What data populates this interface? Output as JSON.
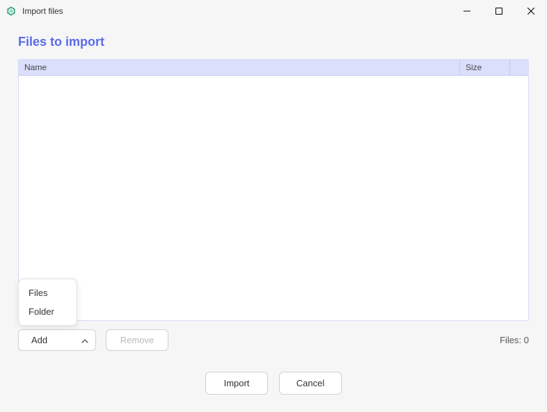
{
  "titlebar": {
    "title": "Import files"
  },
  "page": {
    "heading": "Files to import"
  },
  "table": {
    "columns": {
      "name": "Name",
      "size": "Size"
    }
  },
  "popup": {
    "items": [
      "Files",
      "Folder"
    ]
  },
  "actions": {
    "add": "Add",
    "remove": "Remove",
    "files_label": "Files:",
    "files_count": "0"
  },
  "footer": {
    "import": "Import",
    "cancel": "Cancel"
  }
}
